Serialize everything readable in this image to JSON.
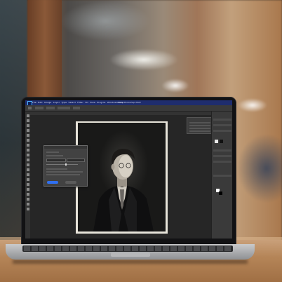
{
  "scene": {
    "description_colors": {
      "table": "#b58558",
      "ps_titlebar": "#1f2d6e",
      "ps_panel": "#3a3a3a",
      "accent_button": "#2f6ff0"
    }
  },
  "photoshop": {
    "window_title": "Adobe Photoshop 2022",
    "menu": [
      "Ps",
      "File",
      "Edit",
      "Image",
      "Layer",
      "Type",
      "Select",
      "Filter",
      "3D",
      "View",
      "Plugins",
      "Window",
      "Help"
    ],
    "tools_count": 20
  },
  "icons": {
    "app_logo": "photoshop-logo-icon",
    "tool": "tool-icon"
  }
}
